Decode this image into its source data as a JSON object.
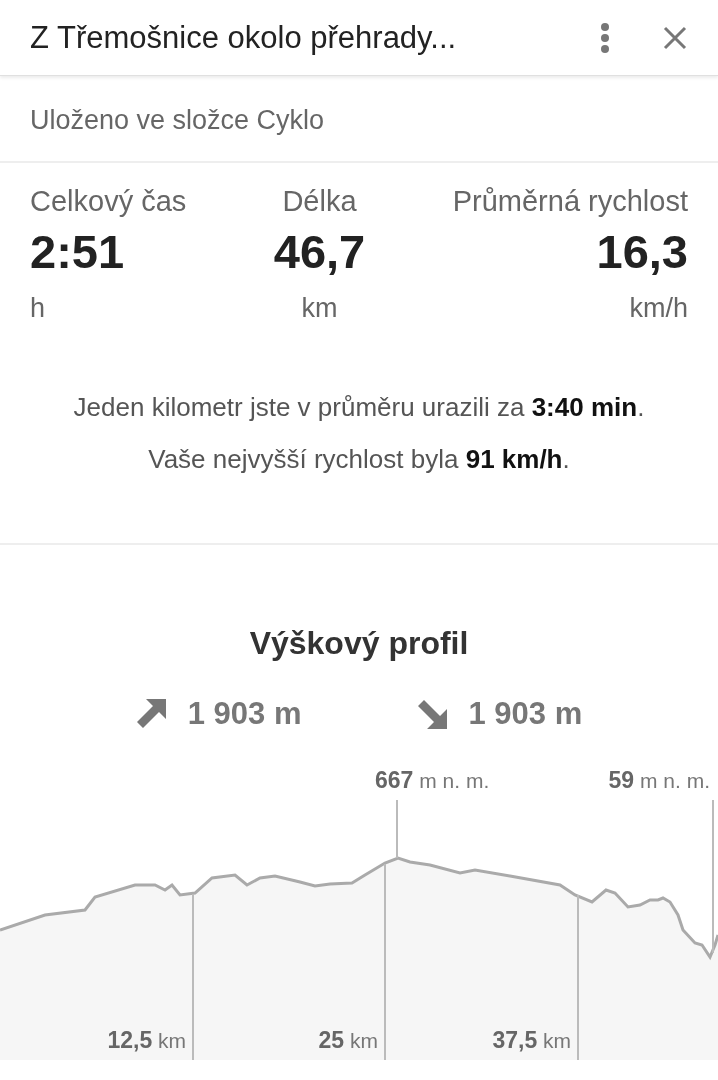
{
  "header": {
    "title": "Z Třemošnice okolo přehrady..."
  },
  "folder": "Uloženo ve složce Cyklo",
  "stats": [
    {
      "label": "Celkový čas",
      "value": "2:51",
      "unit": "h"
    },
    {
      "label": "Délka",
      "value": "46,7",
      "unit": "km"
    },
    {
      "label": "Průměrná rychlost",
      "value": "16,3",
      "unit": "km/h"
    }
  ],
  "summary": [
    "Jeden kilometr jste v průměru urazili za **3:40 min**.",
    "Vaše nejvyšší rychlost byla **91 km/h**."
  ],
  "elevation": {
    "title": "Výškový profil",
    "ascent": "1 903 m",
    "descent": "1 903 m",
    "markers": [
      "**667** m n. m.",
      "**59** m n. m."
    ],
    "distance_labels": [
      "**12,5** km",
      "**25** km",
      "**37,5** km"
    ]
  }
}
